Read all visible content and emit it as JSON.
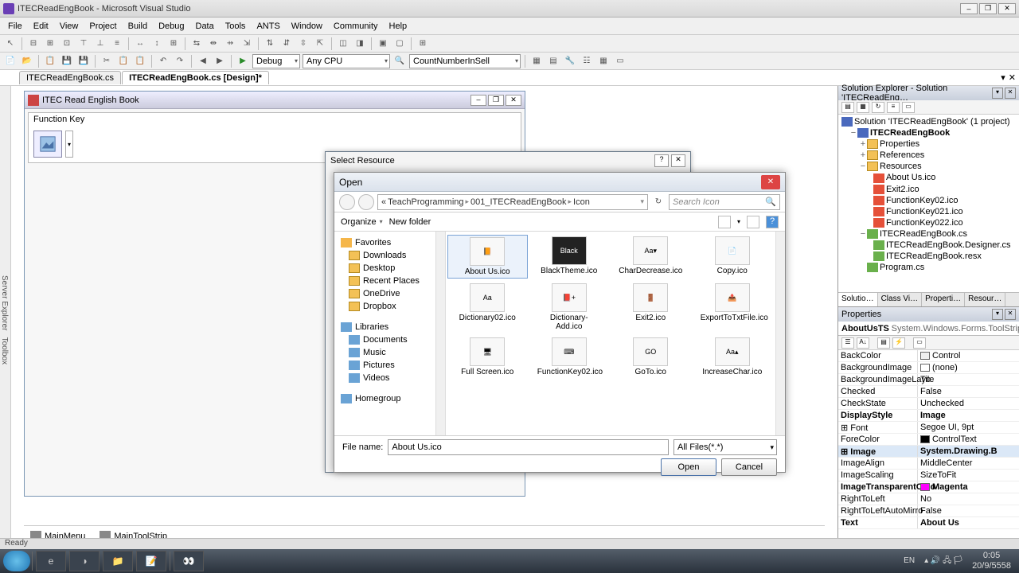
{
  "titlebar": {
    "text": "ITECReadEngBook - Microsoft Visual Studio"
  },
  "menus": [
    "File",
    "Edit",
    "View",
    "Project",
    "Build",
    "Debug",
    "Data",
    "Tools",
    "ANTS",
    "Window",
    "Community",
    "Help"
  ],
  "toolbar2": {
    "config": "Debug",
    "platform": "Any CPU",
    "find": "CountNumberInSell"
  },
  "doctabs": {
    "t1": "ITECReadEngBook.cs",
    "t2": "ITECReadEngBook.cs [Design]*"
  },
  "designer": {
    "form_title": "ITEC Read English Book",
    "group_label": "Function Key",
    "tray": {
      "menu": "MainMenu",
      "tool": "MainToolStrip"
    }
  },
  "selectres": {
    "title": "Select Resource"
  },
  "opendlg": {
    "title": "Open",
    "crumbs": [
      "«",
      "TeachProgramming",
      "001_ITECReadEngBook",
      "Icon"
    ],
    "search_placeholder": "Search Icon",
    "organize": "Organize",
    "newfolder": "New folder",
    "sidebar": {
      "fav": "Favorites",
      "items1": [
        "Downloads",
        "Desktop",
        "Recent Places",
        "OneDrive",
        "Dropbox"
      ],
      "lib": "Libraries",
      "items2": [
        "Documents",
        "Music",
        "Pictures",
        "Videos"
      ],
      "home": "Homegroup"
    },
    "files": [
      {
        "label": "About Us.ico",
        "sel": true,
        "thumb": "📙"
      },
      {
        "label": "BlackTheme.ico",
        "thumb": "Black",
        "dark": true
      },
      {
        "label": "CharDecrease.ico",
        "thumb": "Aa▾"
      },
      {
        "label": "Copy.ico",
        "thumb": "📄"
      },
      {
        "label": "Dictionary02.ico",
        "thumb": "Aa"
      },
      {
        "label": "Dictionary-Add.ico",
        "thumb": "📕+"
      },
      {
        "label": "Exit2.ico",
        "thumb": "🚪"
      },
      {
        "label": "ExportToTxtFile.ico",
        "thumb": "📤"
      },
      {
        "label": "Full Screen.ico",
        "thumb": "🖥"
      },
      {
        "label": "FunctionKey02.ico",
        "thumb": "⌨"
      },
      {
        "label": "GoTo.ico",
        "thumb": "GO"
      },
      {
        "label": "IncreaseChar.ico",
        "thumb": "Aa▴"
      }
    ],
    "filename_label": "File name:",
    "filename_value": "About Us.ico",
    "filter": "All Files(*.*)",
    "open_btn": "Open",
    "cancel_btn": "Cancel"
  },
  "solution": {
    "title": "Solution Explorer - Solution 'ITECReadEng…",
    "root": "Solution 'ITECReadEngBook' (1 project)",
    "proj": "ITECReadEngBook",
    "folders": [
      "Properties",
      "References",
      "Resources"
    ],
    "res_items": [
      "About Us.ico",
      "Exit2.ico",
      "FunctionKey02.ico",
      "FunctionKey021.ico",
      "FunctionKey022.ico"
    ],
    "cs_file": "ITECReadEngBook.cs",
    "cs_children": [
      "ITECReadEngBook.Designer.cs",
      "ITECReadEngBook.resx"
    ],
    "program": "Program.cs",
    "tabs": [
      "Solutio…",
      "Class Vi…",
      "Properti…",
      "Resour…"
    ]
  },
  "props": {
    "title": "Properties",
    "obj_name": "AboutUsTS",
    "obj_type": "System.Windows.Forms.ToolStripButt…",
    "rows": [
      {
        "n": "BackColor",
        "v": "Control",
        "sw": "#f0f0f0"
      },
      {
        "n": "BackgroundImage",
        "v": "(none)",
        "sw": "#fff"
      },
      {
        "n": "BackgroundImageLayo",
        "v": "Tile"
      },
      {
        "n": "Checked",
        "v": "False"
      },
      {
        "n": "CheckState",
        "v": "Unchecked"
      },
      {
        "n": "DisplayStyle",
        "v": "Image",
        "bold": true
      },
      {
        "n": "Font",
        "v": "Segoe UI, 9pt",
        "exp": true
      },
      {
        "n": "ForeColor",
        "v": "ControlText",
        "sw": "#000"
      },
      {
        "n": "Image",
        "v": "System.Drawing.B",
        "sel": true,
        "bold": true,
        "exp": true
      },
      {
        "n": "ImageAlign",
        "v": "MiddleCenter"
      },
      {
        "n": "ImageScaling",
        "v": "SizeToFit"
      },
      {
        "n": "ImageTransparentColo",
        "v": "Magenta",
        "sw": "#ff00ff",
        "bold": true
      },
      {
        "n": "RightToLeft",
        "v": "No"
      },
      {
        "n": "RightToLeftAutoMirro",
        "v": "False"
      },
      {
        "n": "Text",
        "v": "About Us",
        "bold": true
      }
    ]
  },
  "status": "Ready",
  "tray": {
    "lang": "EN",
    "time": "0:05",
    "date": "20/9/5558"
  }
}
